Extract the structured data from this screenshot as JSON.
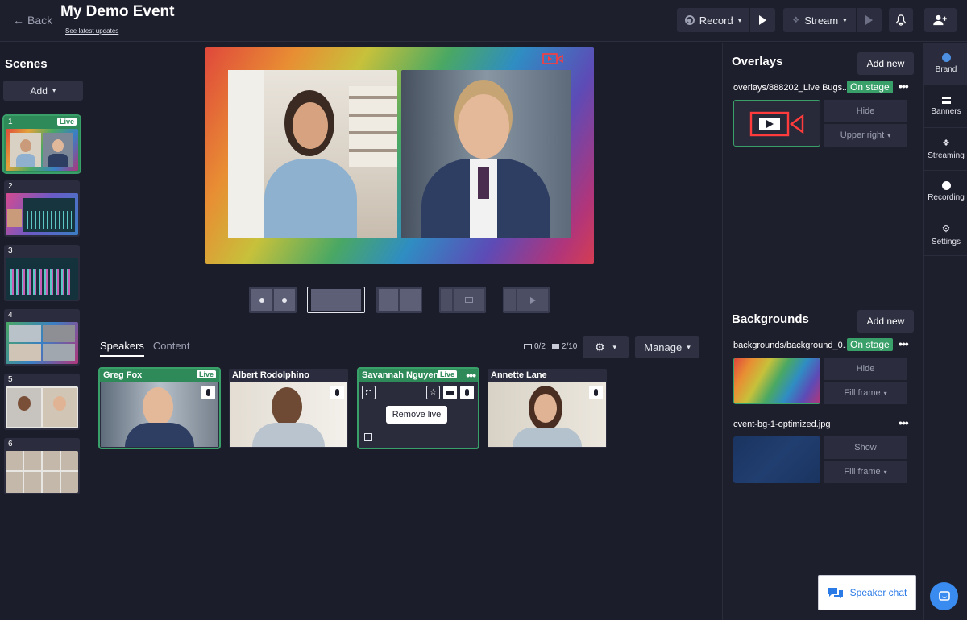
{
  "header": {
    "back_label": "Back",
    "event_title": "My Demo Event",
    "updates_link": "See latest updates",
    "record_label": "Record",
    "stream_label": "Stream"
  },
  "scenes": {
    "title": "Scenes",
    "add_label": "Add",
    "items": [
      {
        "num": "1",
        "live": "Live"
      },
      {
        "num": "2"
      },
      {
        "num": "3"
      },
      {
        "num": "4"
      },
      {
        "num": "5"
      },
      {
        "num": "6"
      }
    ]
  },
  "stage": {
    "tabs": [
      "Speakers",
      "Content"
    ],
    "screens_count": "0/2",
    "cams_count": "2/10",
    "manage_label": "Manage"
  },
  "speakers": [
    {
      "name": "Greg Fox",
      "badge": "Live"
    },
    {
      "name": "Albert Rodolphino"
    },
    {
      "name": "Savannah Nguyen",
      "badge": "Live",
      "tooltip": "Remove live"
    },
    {
      "name": "Annette Lane"
    }
  ],
  "overlays": {
    "title": "Overlays",
    "add_new": "Add new",
    "item_name": "overlays/888202_Live Bugs...",
    "status": "On stage",
    "hide_label": "Hide",
    "position_label": "Upper right"
  },
  "backgrounds": {
    "title": "Backgrounds",
    "add_new": "Add new",
    "items": [
      {
        "name": "backgrounds/background_0...",
        "status": "On stage",
        "action": "Hide",
        "fit": "Fill frame"
      },
      {
        "name": "cvent-bg-1-optimized.jpg",
        "action": "Show",
        "fit": "Fill frame"
      }
    ]
  },
  "sidenav": [
    "Brand",
    "Banners",
    "Streaming",
    "Recording",
    "Settings"
  ],
  "chat": {
    "label": "Speaker chat"
  },
  "colors": {
    "accent_green": "#3aa06a",
    "bg": "#1c1d2b",
    "chat_blue": "#2b7be6"
  }
}
